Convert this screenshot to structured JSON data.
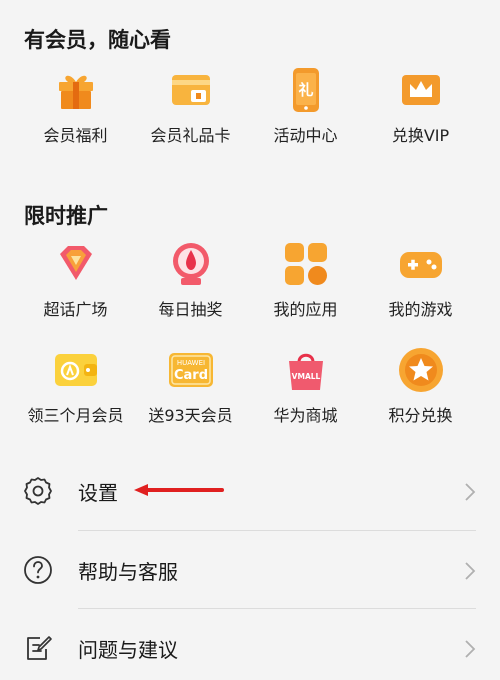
{
  "member": {
    "title": "有会员，随心看",
    "items": [
      {
        "label": "会员福利",
        "icon": "gift-icon"
      },
      {
        "label": "会员礼品卡",
        "icon": "gift-card-icon"
      },
      {
        "label": "活动中心",
        "icon": "event-phone-icon"
      },
      {
        "label": "兑换VIP",
        "icon": "crown-icon"
      }
    ]
  },
  "promo": {
    "title": "限时推广",
    "items": [
      {
        "label": "超话广场",
        "icon": "diamond-icon"
      },
      {
        "label": "每日抽奖",
        "icon": "lottery-icon"
      },
      {
        "label": "我的应用",
        "icon": "apps-icon"
      },
      {
        "label": "我的游戏",
        "icon": "gamepad-icon"
      },
      {
        "label": "领三个月会员",
        "icon": "wallet-icon"
      },
      {
        "label": "送93天会员",
        "icon": "huawei-card-icon"
      },
      {
        "label": "华为商城",
        "icon": "vmall-bag-icon"
      },
      {
        "label": "积分兑换",
        "icon": "star-coin-icon"
      }
    ]
  },
  "card_badge": {
    "brand": "HUAWEI",
    "text": "Card"
  },
  "vmall_badge": "VMALL",
  "menu": [
    {
      "label": "设置",
      "icon": "gear-icon"
    },
    {
      "label": "帮助与客服",
      "icon": "help-icon"
    },
    {
      "label": "问题与建议",
      "icon": "feedback-icon"
    }
  ],
  "colors": {
    "accent": "#f5a623",
    "arrow": "#e02020"
  }
}
